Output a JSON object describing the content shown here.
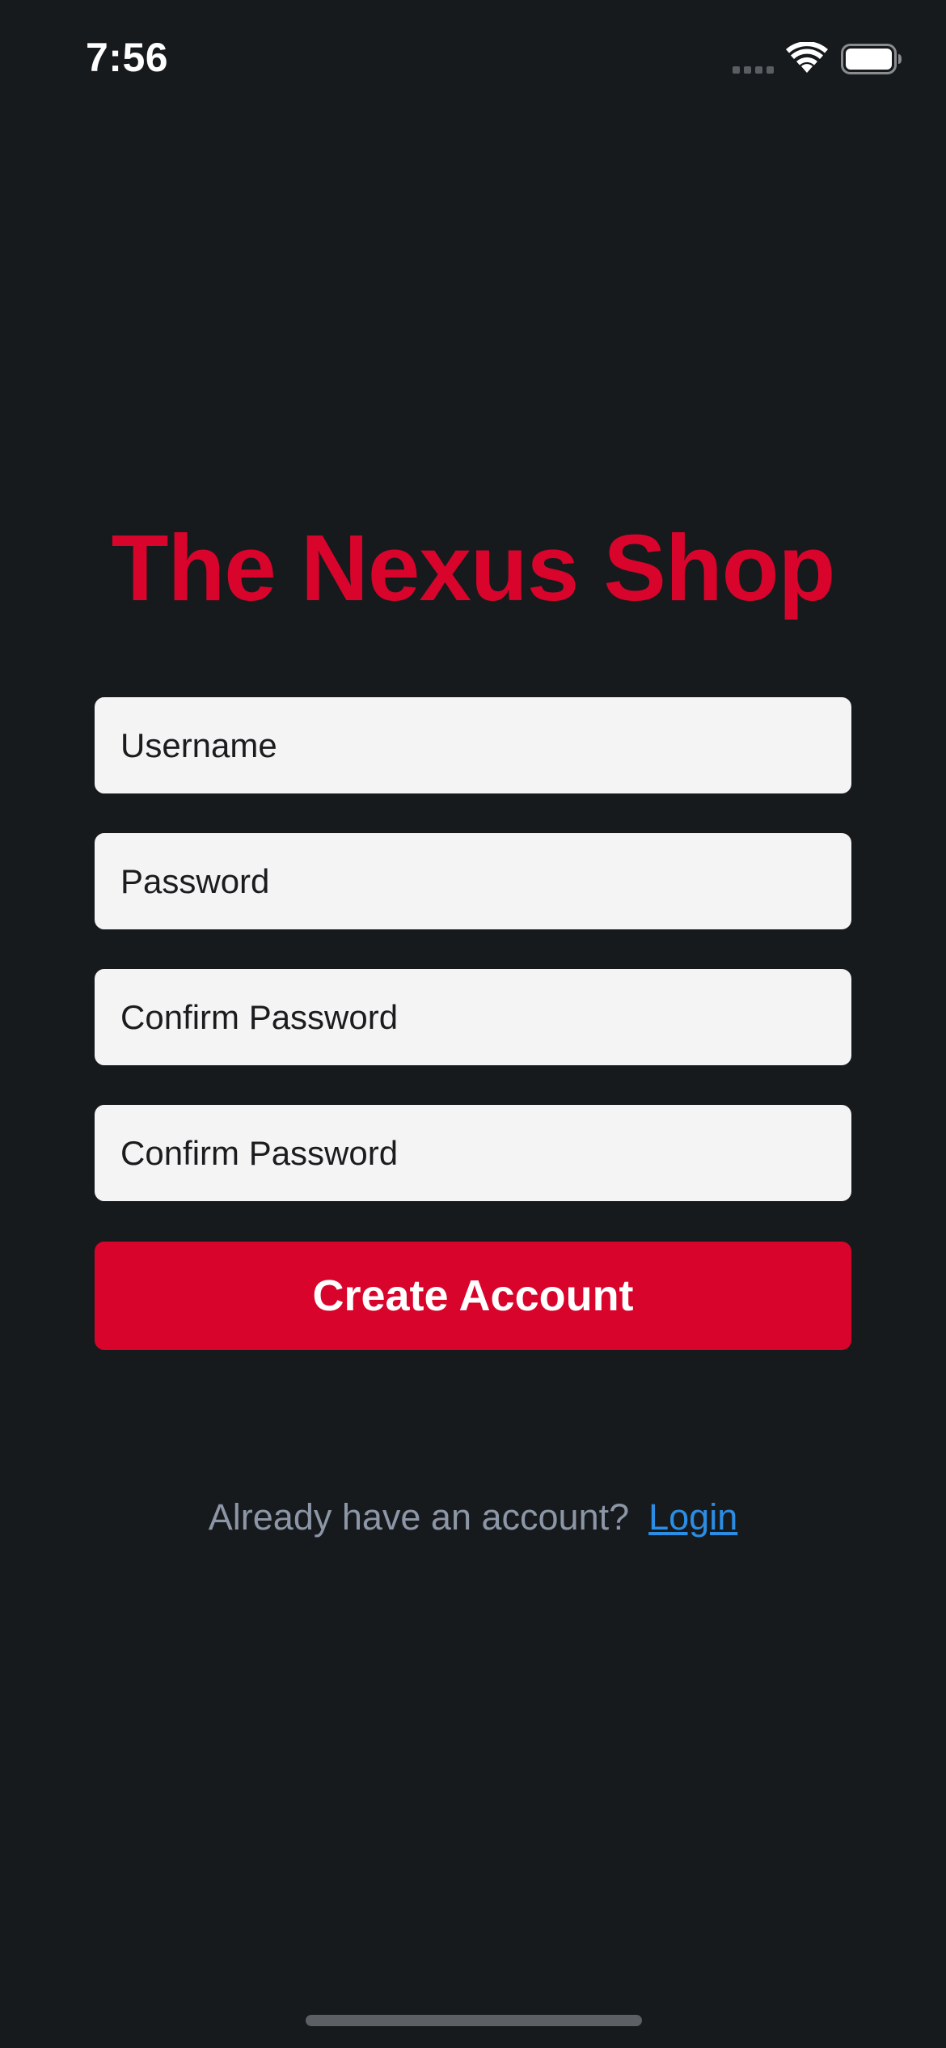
{
  "status_bar": {
    "time": "7:56",
    "signal_icon": "cellular-signal-icon",
    "wifi_icon": "wifi-icon",
    "battery_icon": "battery-icon"
  },
  "brand": {
    "title": "The Nexus Shop",
    "color": "#d9042b"
  },
  "form": {
    "username_placeholder": "Username",
    "password_placeholder": "Password",
    "confirm_password_placeholder": "Confirm Password",
    "confirm_password_2_placeholder": "Confirm Password",
    "submit_label": "Create Account"
  },
  "footer": {
    "prompt": "Already have an account?",
    "login_label": "Login",
    "link_color": "#2c8de4"
  },
  "colors": {
    "background": "#171a1d",
    "accent": "#d9042b",
    "field_background": "#f5f4f5"
  }
}
